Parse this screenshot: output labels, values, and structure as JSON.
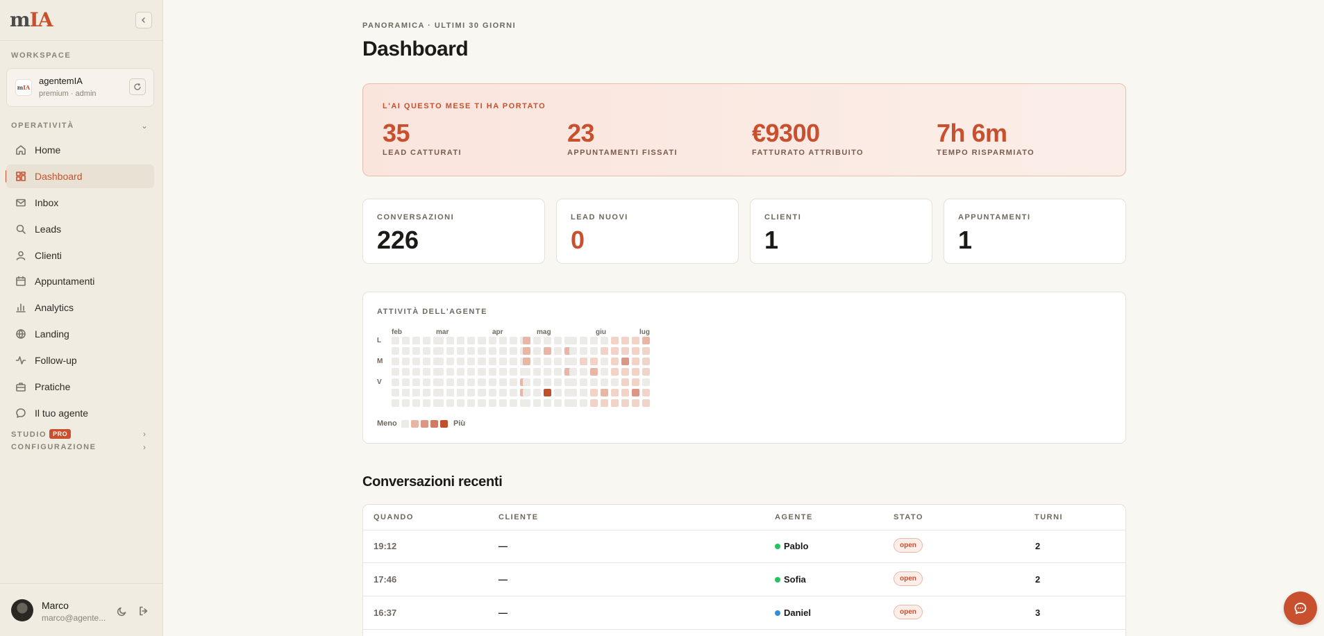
{
  "brand": {
    "logo_prefix": "m",
    "logo_accent": "IA"
  },
  "sidebar": {
    "workspace_label": "WORKSPACE",
    "workspace": {
      "avatar_prefix": "m",
      "avatar_accent": "IA",
      "name": "agentemIA",
      "sub": "premium · admin"
    },
    "operativita_label": "OPERATIVITÀ",
    "items": [
      {
        "label": "Home",
        "icon": "home-icon"
      },
      {
        "label": "Dashboard",
        "icon": "grid-icon",
        "active": true
      },
      {
        "label": "Inbox",
        "icon": "mail-icon"
      },
      {
        "label": "Leads",
        "icon": "search-icon"
      },
      {
        "label": "Clienti",
        "icon": "user-icon"
      },
      {
        "label": "Appuntamenti",
        "icon": "calendar-icon"
      },
      {
        "label": "Analytics",
        "icon": "bar-chart-icon"
      },
      {
        "label": "Landing",
        "icon": "globe-icon"
      },
      {
        "label": "Follow-up",
        "icon": "pulse-icon"
      },
      {
        "label": "Pratiche",
        "icon": "briefcase-icon"
      },
      {
        "label": "Il tuo agente",
        "icon": "chat-icon"
      }
    ],
    "studio_label": "STUDIO",
    "pro_badge": "PRO",
    "config_label": "CONFIGURAZIONE",
    "user": {
      "name": "Marco",
      "email": "marco@agente..."
    }
  },
  "header": {
    "eyebrow": "PANORAMICA · ULTIMI 30 GIORNI",
    "title": "Dashboard"
  },
  "ai_summary": {
    "eyebrow": "L'AI QUESTO MESE TI HA PORTATO",
    "metrics": [
      {
        "value": "35",
        "label": "LEAD CATTURATI"
      },
      {
        "value": "23",
        "label": "APPUNTAMENTI FISSATI"
      },
      {
        "value": "€9300",
        "label": "FATTURATO ATTRIBUITO"
      },
      {
        "value": "7h 6m",
        "label": "TEMPO RISPARMIATO"
      }
    ]
  },
  "stats": [
    {
      "label": "CONVERSAZIONI",
      "value": "226"
    },
    {
      "label": "LEAD NUOVI",
      "value": "0",
      "accent": true
    },
    {
      "label": "CLIENTI",
      "value": "1"
    },
    {
      "label": "APPUNTAMENTI",
      "value": "1"
    }
  ],
  "activity": {
    "title": "ATTIVITÀ DELL'AGENTE",
    "months": [
      "feb",
      "mar",
      "apr",
      "mag",
      "giu",
      "lug"
    ],
    "days": [
      "L",
      "M",
      "V"
    ],
    "legend_less": "Meno",
    "legend_more": "Più",
    "colors": [
      "#ecebe8",
      "#f2d3c8",
      "#e9b6a5",
      "#dc9683",
      "#cf7a63",
      "#c0502c"
    ],
    "weeks": [
      [
        0,
        0,
        0,
        0,
        0,
        0,
        0
      ],
      [
        0,
        0,
        0,
        0,
        0,
        0,
        0
      ],
      [
        0,
        0,
        0,
        0,
        0,
        0,
        0
      ],
      [
        0,
        0,
        0,
        0,
        0,
        0,
        0
      ],
      [
        0,
        0,
        0,
        0,
        0,
        0,
        0
      ],
      [
        0,
        0,
        0,
        0,
        0,
        0,
        0
      ],
      [
        0,
        0,
        0,
        0,
        0,
        0,
        0
      ],
      [
        0,
        0,
        0,
        0,
        0,
        0,
        0
      ],
      [
        0,
        0,
        0,
        0,
        0,
        0,
        0
      ],
      [
        0,
        0,
        0,
        0,
        0,
        0,
        0
      ],
      [
        0,
        0,
        0,
        0,
        0,
        0,
        0
      ],
      [
        0,
        0,
        0,
        0,
        0,
        0,
        0
      ],
      [
        0,
        0,
        0,
        0,
        0,
        0,
        0
      ],
      [
        0,
        0,
        0,
        0,
        0,
        0,
        0
      ],
      [
        0,
        0,
        0,
        0,
        2,
        2,
        0
      ],
      [
        2,
        2,
        2,
        0,
        0,
        0,
        0
      ],
      [
        0,
        0,
        0,
        0,
        0,
        0,
        0
      ],
      [
        0,
        2,
        0,
        0,
        0,
        5,
        0
      ],
      [
        0,
        0,
        0,
        0,
        0,
        0,
        0
      ],
      [
        0,
        2,
        0,
        2,
        0,
        0,
        0
      ],
      [
        0,
        0,
        0,
        0,
        0,
        0,
        0
      ],
      [
        0,
        0,
        1,
        0,
        0,
        0,
        0
      ],
      [
        0,
        0,
        1,
        2,
        0,
        1,
        1
      ],
      [
        0,
        1,
        0,
        0,
        0,
        2,
        1
      ],
      [
        1,
        1,
        1,
        1,
        0,
        1,
        1
      ],
      [
        1,
        1,
        3,
        1,
        1,
        1,
        1
      ],
      [
        1,
        1,
        1,
        1,
        1,
        3,
        1
      ],
      [
        2,
        1,
        1,
        1,
        0,
        1,
        1
      ]
    ]
  },
  "recent": {
    "title": "Conversazioni recenti",
    "columns": {
      "when": "QUANDO",
      "client": "CLIENTE",
      "agent": "AGENTE",
      "status": "STATO",
      "turns": "TURNI"
    },
    "rows": [
      {
        "when": "19:12",
        "client": "—",
        "agent": "Pablo",
        "dot": "#22c55e",
        "status": "open",
        "turns": "2"
      },
      {
        "when": "17:46",
        "client": "—",
        "agent": "Sofia",
        "dot": "#22c55e",
        "status": "open",
        "turns": "2"
      },
      {
        "when": "16:37",
        "client": "—",
        "agent": "Daniel",
        "dot": "#2f8fd8",
        "status": "open",
        "turns": "3"
      }
    ]
  }
}
